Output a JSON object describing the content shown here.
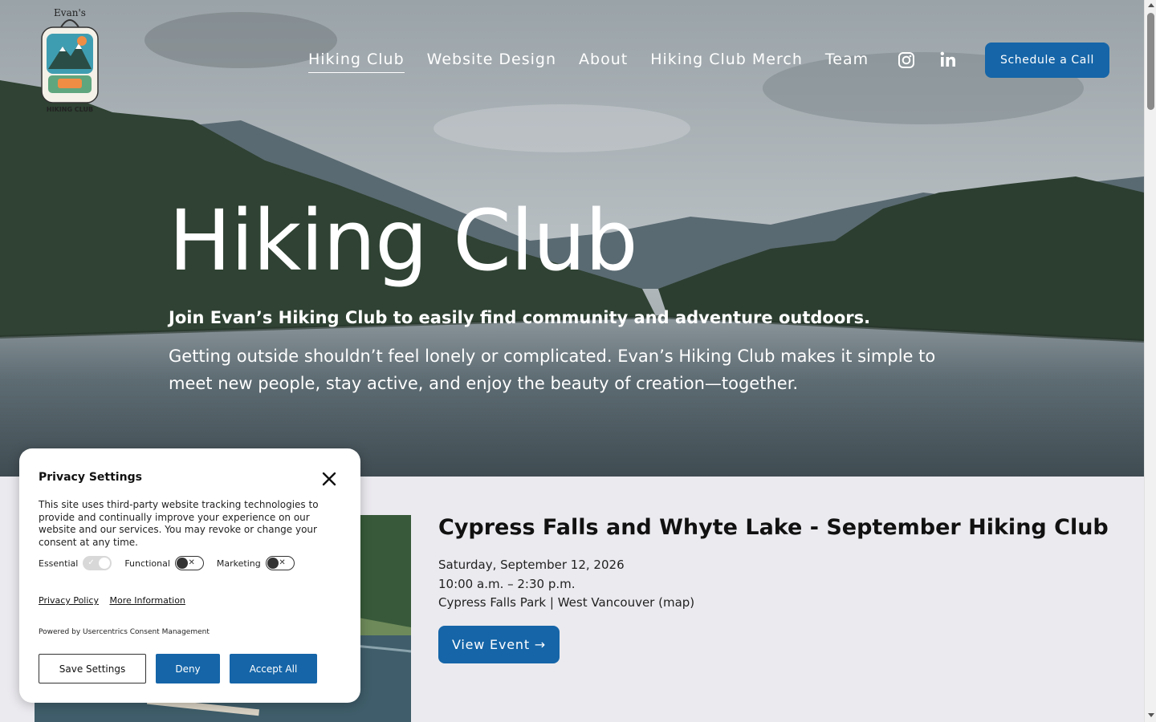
{
  "nav": {
    "items": [
      {
        "label": "Hiking Club",
        "active": true
      },
      {
        "label": "Website Design",
        "active": false
      },
      {
        "label": "About",
        "active": false
      },
      {
        "label": "Hiking Club Merch",
        "active": false
      },
      {
        "label": "Team",
        "active": false
      }
    ],
    "social_icons": [
      "instagram-icon",
      "linkedin-icon"
    ],
    "cta_label": "Schedule a Call"
  },
  "logo": {
    "top_text": "Evan's",
    "bottom_text": "HIKING CLUB"
  },
  "hero": {
    "title": "Hiking Club",
    "subtitle": "Join Evan’s Hiking Club to easily find community and adventure outdoors.",
    "body": "Getting outside shouldn’t feel lonely or complicated. Evan’s Hiking Club makes it simple to meet new people, stay active, and enjoy the beauty of creation—together."
  },
  "event": {
    "title": "Cypress Falls and Whyte Lake - September Hiking Club",
    "date": "Saturday, September 12, 2026",
    "time": "10:00 a.m. – 2:30 p.m.",
    "location": "Cypress Falls Park | West Vancouver (map)",
    "button_label": "View Event →"
  },
  "privacy": {
    "title": "Privacy Settings",
    "description": "This site uses third-party website tracking technologies to provide and continually improve your experience on our website and our services. You may revoke or change your consent at any time.",
    "toggles": [
      {
        "label": "Essential",
        "state": "on-disabled"
      },
      {
        "label": "Functional",
        "state": "off"
      },
      {
        "label": "Marketing",
        "state": "off"
      }
    ],
    "links": [
      "Privacy Policy",
      "More Information"
    ],
    "powered_by": "Powered by Usercentrics Consent Management",
    "buttons": {
      "save": "Save Settings",
      "deny": "Deny",
      "accept": "Accept All"
    }
  },
  "colors": {
    "accent": "#1565a8",
    "page_bg": "#ebeaef"
  }
}
